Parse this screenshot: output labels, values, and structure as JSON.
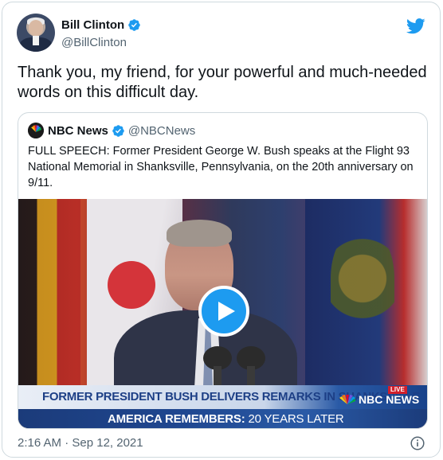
{
  "author": {
    "name": "Bill Clinton",
    "handle": "@BillClinton",
    "avatar_icon": "profile-photo",
    "verified_icon": "verified-badge-icon"
  },
  "tweet": {
    "text": "Thank you, my friend, for your powerful and much-needed words on this difficult day.",
    "timestamp": "2:16 AM · Sep 12, 2021"
  },
  "quoted": {
    "name": "NBC News",
    "handle": "@NBCNews",
    "text": "FULL SPEECH: Former President George W. Bush speaks at the Flight 93 National Memorial in Shanksville, Pennsylvania, on the 20th anniversary on 9/11.",
    "video": {
      "lower_third_top": "FORMER PRESIDENT BUSH DELIVERS REMARKS IN SHANKSVILLE",
      "live_badge": "LIVE",
      "network_bug": "NBC NEWS",
      "lower_third_bottom_bold": "AMERICA REMEMBERS:",
      "lower_third_bottom_rest": " 20 YEARS LATER"
    }
  },
  "colors": {
    "brand_blue": "#1d9bf0",
    "text_primary": "#0f1419",
    "text_secondary": "#536471",
    "border": "#cfd9de"
  }
}
